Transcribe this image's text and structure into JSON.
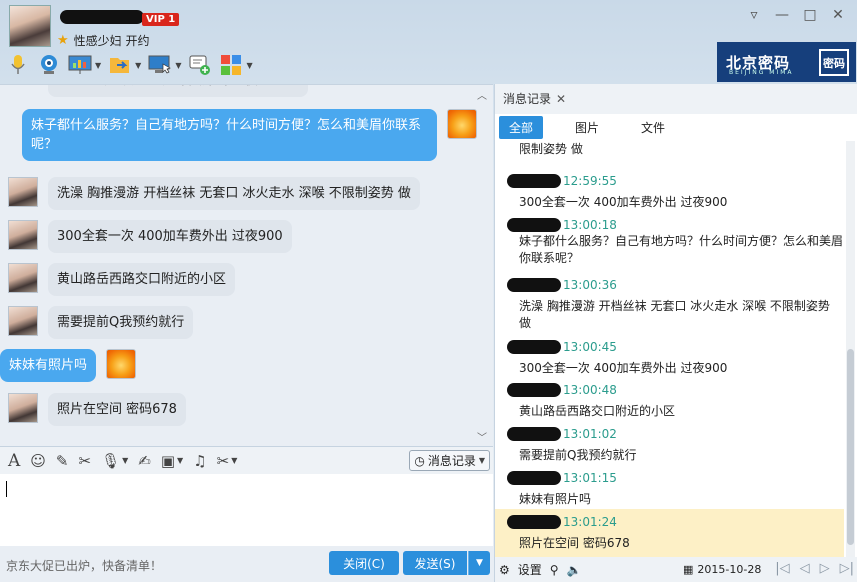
{
  "header": {
    "vip_label": "VIP 1",
    "status_text": "性感少妇 开约",
    "window_controls": [
      "▿",
      "—",
      "□",
      "✕"
    ]
  },
  "brand": {
    "title": "北京密码",
    "subtitle": "BEIJING MIMA",
    "box": "密码"
  },
  "chat": {
    "partial_top": "300全套一次   400加车费外出   过夜900",
    "messages": [
      {
        "side": "self",
        "text": "妹子都什么服务？自己有地方吗？什么时间方便？怎么和美眉你联系呢？"
      },
      {
        "side": "other",
        "text": "洗澡 胸推漫游 开档丝袜 无套口  冰火走水 深喉 不限制姿势  做"
      },
      {
        "side": "other",
        "text": "300全套一次    400加车费外出    过夜900"
      },
      {
        "side": "other",
        "text": "黄山路岳西路交口附近的小区"
      },
      {
        "side": "other",
        "text": "    需要提前Q我预约就行"
      },
      {
        "side": "self",
        "text": "妹妹有照片吗"
      },
      {
        "side": "other",
        "text": "照片在空间 密码678"
      }
    ]
  },
  "input": {
    "history_button": "消息记录",
    "footer_ad": "京东大促已出炉，快备清单！",
    "close_button": "关闭(C)",
    "send_button": "发送(S)"
  },
  "side": {
    "tab_title": "消息记录",
    "filters": [
      "全部",
      "图片",
      "文件"
    ],
    "history": [
      {
        "time": "",
        "text": "限制姿势  做"
      },
      {
        "time": "12:59:55",
        "text": "300全套一次   400加车费外出   过夜900"
      },
      {
        "time": "13:00:18",
        "text": "妹子都什么服务？自己有地方吗？什么时间方便？怎么和美眉你联系呢？"
      },
      {
        "time": "13:00:36",
        "text": "洗澡 胸推漫游 开档丝袜 无套口  冰火走水 深喉 不限制姿势  做"
      },
      {
        "time": "13:00:45",
        "text": "300全套一次    400加车费外出    过夜900"
      },
      {
        "time": "13:00:48",
        "text": "黄山路岳西路交口附近的小区"
      },
      {
        "time": "13:01:02",
        "text": "  需要提前Q我预约就行"
      },
      {
        "time": "13:01:15",
        "text": "妹妹有照片吗"
      },
      {
        "time": "13:01:24",
        "text": "照片在空间 密码678"
      }
    ],
    "footer_settings": "设置",
    "date": "2015-10-28"
  }
}
